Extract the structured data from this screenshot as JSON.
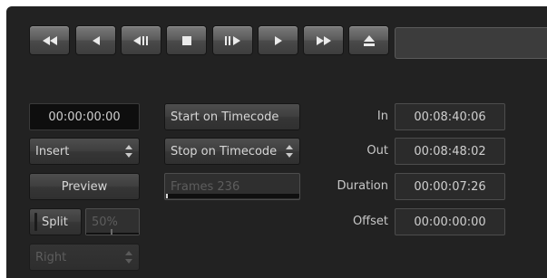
{
  "transport": {
    "buttons": [
      {
        "name": "rewind-button",
        "icon": "rewind-icon"
      },
      {
        "name": "previous-frame-button",
        "icon": "step-back-icon"
      },
      {
        "name": "reverse-play-button",
        "icon": "reverse-play-icon"
      },
      {
        "name": "stop-button",
        "icon": "stop-icon"
      },
      {
        "name": "play-pause-button",
        "icon": "pause-play-icon"
      },
      {
        "name": "play-button",
        "icon": "play-icon"
      },
      {
        "name": "fast-forward-button",
        "icon": "fast-forward-icon"
      },
      {
        "name": "eject-button",
        "icon": "eject-icon"
      }
    ]
  },
  "left": {
    "timecode": "00:00:00:00",
    "mode_select": "Insert",
    "preview_label": "Preview",
    "split_label": "Split",
    "split_percent": "50%",
    "side_select": "Right"
  },
  "middle": {
    "start_on_timecode": "Start on Timecode",
    "stop_on_timecode": "Stop on Timecode",
    "frames_field": "Frames 236",
    "frames_progress": 0.01
  },
  "right": {
    "in_label": "In",
    "in_value": "00:08:40:06",
    "out_label": "Out",
    "out_value": "00:08:48:02",
    "duration_label": "Duration",
    "duration_value": "00:00:07:26",
    "offset_label": "Offset",
    "offset_value": "00:00:00:00"
  }
}
